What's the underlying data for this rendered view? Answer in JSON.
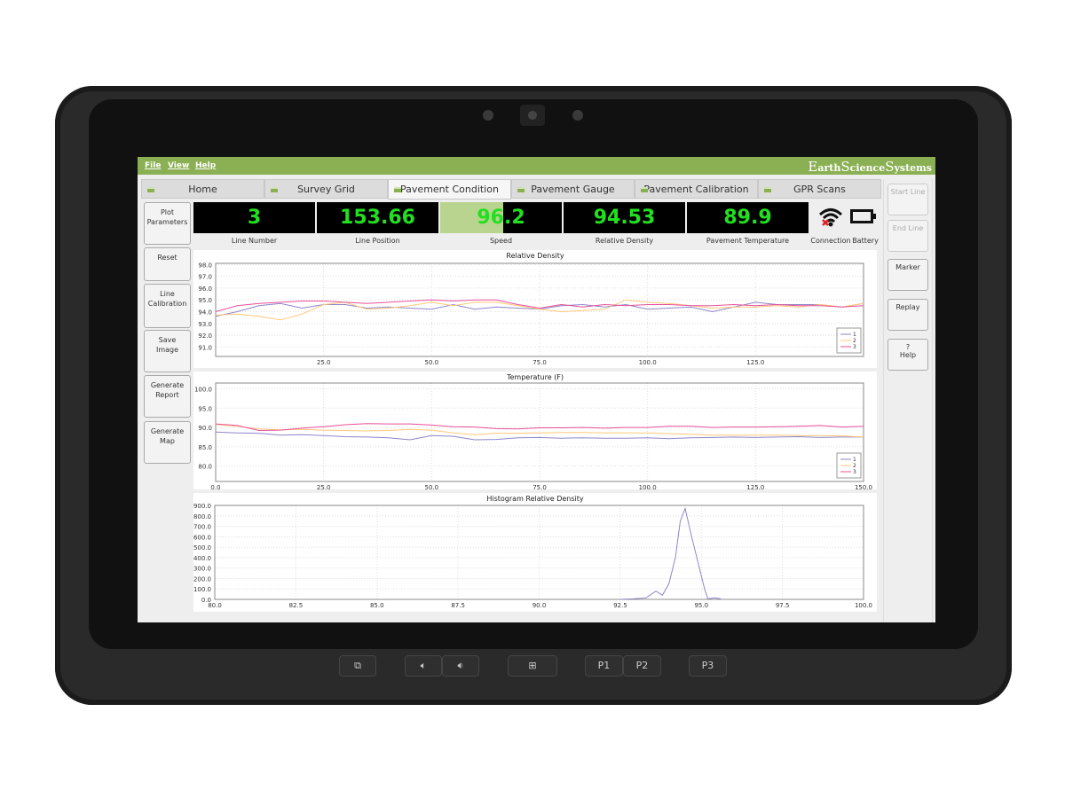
{
  "menu": [
    "File",
    "View",
    "Help"
  ],
  "brand": {
    "first": [
      "E",
      "S",
      "S"
    ],
    "rest": [
      "arth",
      "cience",
      "ystems"
    ]
  },
  "tabs": [
    {
      "label": "Home"
    },
    {
      "label": "Survey Grid"
    },
    {
      "label": "Pavement Condition",
      "active": true
    },
    {
      "label": "Pavement Gauge"
    },
    {
      "label": "Pavement Calibration"
    },
    {
      "label": "GPR Scans"
    }
  ],
  "left_buttons": [
    {
      "label1": "Plot",
      "label2": "Parameters",
      "icon": "plot-icon"
    },
    {
      "label1": "Reset",
      "label2": "",
      "icon": "reset-icon"
    },
    {
      "label1": "Line",
      "label2": "Calibration",
      "icon": "scale-icon"
    },
    {
      "label1": "Save",
      "label2": "Image",
      "icon": "image-icon"
    },
    {
      "label1": "Generate",
      "label2": "Report",
      "icon": "report-icon"
    },
    {
      "label1": "Generate",
      "label2": "Map",
      "icon": "map-icon"
    }
  ],
  "readouts": [
    {
      "value": "3",
      "label": "Line Number"
    },
    {
      "value": "153.66",
      "label": "Line Position"
    },
    {
      "value": "96.2",
      "label": "Speed",
      "fill_fraction": 0.52
    },
    {
      "value": "94.53",
      "label": "Relative Density"
    },
    {
      "value": "89.9",
      "label": "Pavement Temperature"
    }
  ],
  "status": {
    "connection_label": "Connection",
    "battery_label": "Battery",
    "connection": "disconnected",
    "battery_level": 0
  },
  "right_buttons": [
    {
      "label": "Start Line",
      "disabled": true
    },
    {
      "label": "End Line",
      "disabled": true
    },
    {
      "label": "Marker"
    },
    {
      "label": "Replay"
    },
    {
      "label": "Help"
    }
  ],
  "hardware_buttons": [
    "P1",
    "P2",
    "P3"
  ],
  "colors": {
    "accent": "#8bb053",
    "readout": "#22e020",
    "series1": "#8d86c9",
    "series2": "#ffc87a",
    "series3": "#e8509a"
  },
  "chart_data": [
    {
      "type": "line",
      "title": "Relative Density",
      "xlim": [
        0,
        150
      ],
      "ylim": [
        90.2,
        98.1
      ],
      "xticks": [
        25,
        50,
        75,
        100,
        125
      ],
      "yticks": [
        91,
        92,
        93,
        94,
        95,
        96,
        97,
        98
      ],
      "grid": true,
      "legend": "bottom-right",
      "x": [
        0,
        5,
        10,
        15,
        20,
        25,
        30,
        35,
        40,
        45,
        50,
        55,
        60,
        65,
        70,
        75,
        80,
        85,
        90,
        95,
        100,
        105,
        110,
        115,
        120,
        125,
        130,
        135,
        140,
        145,
        150
      ],
      "series": [
        {
          "name": "1",
          "values": [
            93.6,
            94.0,
            94.5,
            94.7,
            94.3,
            94.6,
            94.6,
            94.3,
            94.4,
            94.3,
            94.2,
            94.6,
            94.2,
            94.4,
            94.3,
            94.2,
            94.5,
            94.6,
            94.4,
            94.6,
            94.2,
            94.3,
            94.4,
            94.0,
            94.4,
            94.8,
            94.6,
            94.6,
            94.6,
            94.4,
            94.7
          ]
        },
        {
          "name": "2",
          "values": [
            93.7,
            93.8,
            93.6,
            93.3,
            93.8,
            94.6,
            94.8,
            94.2,
            94.3,
            94.5,
            94.8,
            94.5,
            94.8,
            94.8,
            94.5,
            94.2,
            94.0,
            94.1,
            94.2,
            95.0,
            94.8,
            94.7,
            94.5,
            94.3,
            94.4,
            94.4,
            94.5,
            94.4,
            94.6,
            94.4,
            94.7
          ]
        },
        {
          "name": "3",
          "values": [
            94.0,
            94.5,
            94.7,
            94.8,
            94.9,
            94.9,
            94.8,
            94.7,
            94.8,
            94.9,
            95.0,
            94.9,
            95.0,
            95.0,
            94.6,
            94.3,
            94.6,
            94.4,
            94.6,
            94.5,
            94.6,
            94.6,
            94.5,
            94.5,
            94.6,
            94.5,
            94.6,
            94.5,
            94.5,
            94.4,
            94.5
          ]
        }
      ]
    },
    {
      "type": "line",
      "title": "Temperature (F)",
      "xlim": [
        0,
        150
      ],
      "ylim": [
        76,
        101.5
      ],
      "xticks": [
        0,
        25,
        50,
        75,
        100,
        125,
        150
      ],
      "yticks": [
        80,
        85,
        90,
        95,
        100
      ],
      "grid": true,
      "legend": "bottom-right",
      "x": [
        0,
        5,
        10,
        15,
        20,
        25,
        30,
        35,
        40,
        45,
        50,
        55,
        60,
        65,
        70,
        75,
        80,
        85,
        90,
        95,
        100,
        105,
        110,
        115,
        120,
        125,
        130,
        135,
        140,
        145,
        150
      ],
      "series": [
        {
          "name": "1",
          "values": [
            88.8,
            88.6,
            88.5,
            88.0,
            88.1,
            87.9,
            87.6,
            87.5,
            87.3,
            86.8,
            87.9,
            87.7,
            86.8,
            86.9,
            87.3,
            87.4,
            87.2,
            87.3,
            87.2,
            87.2,
            87.3,
            87.1,
            87.3,
            87.4,
            87.5,
            87.4,
            87.5,
            87.6,
            87.4,
            87.5,
            87.5
          ]
        },
        {
          "name": "2",
          "values": [
            90.8,
            90.3,
            89.6,
            89.4,
            89.5,
            89.3,
            89.2,
            89.1,
            89.2,
            89.5,
            89.3,
            88.6,
            88.1,
            88.5,
            88.5,
            88.6,
            88.7,
            88.7,
            88.6,
            88.6,
            88.6,
            88.4,
            88.2,
            88.0,
            88.0,
            88.0,
            88.0,
            87.9,
            87.9,
            87.8,
            87.5
          ]
        },
        {
          "name": "3",
          "values": [
            90.9,
            90.5,
            89.2,
            89.3,
            89.8,
            90.2,
            90.7,
            91.0,
            90.9,
            90.9,
            90.6,
            90.2,
            90.1,
            89.7,
            89.6,
            89.9,
            89.9,
            90.0,
            89.8,
            90.0,
            90.0,
            90.3,
            90.3,
            90.0,
            90.1,
            90.1,
            90.2,
            90.3,
            90.5,
            90.1,
            90.3
          ]
        }
      ]
    },
    {
      "type": "line",
      "title": "Histogram Relative Density",
      "xlim": [
        80,
        100
      ],
      "ylim": [
        0,
        900
      ],
      "xticks": [
        80,
        82.5,
        85,
        87.5,
        90,
        92.5,
        95,
        97.5,
        100
      ],
      "yticks": [
        0,
        100,
        200,
        300,
        400,
        500,
        600,
        700,
        800,
        900
      ],
      "grid": true,
      "x": [
        92.5,
        92.9,
        93.3,
        93.6,
        93.8,
        94.0,
        94.2,
        94.35,
        94.5,
        94.7,
        94.9,
        95.1,
        95.2,
        95.4,
        95.6
      ],
      "series": [
        {
          "values": [
            0,
            5,
            15,
            80,
            40,
            150,
            400,
            750,
            870,
            600,
            350,
            100,
            5,
            15,
            5
          ]
        }
      ]
    }
  ]
}
